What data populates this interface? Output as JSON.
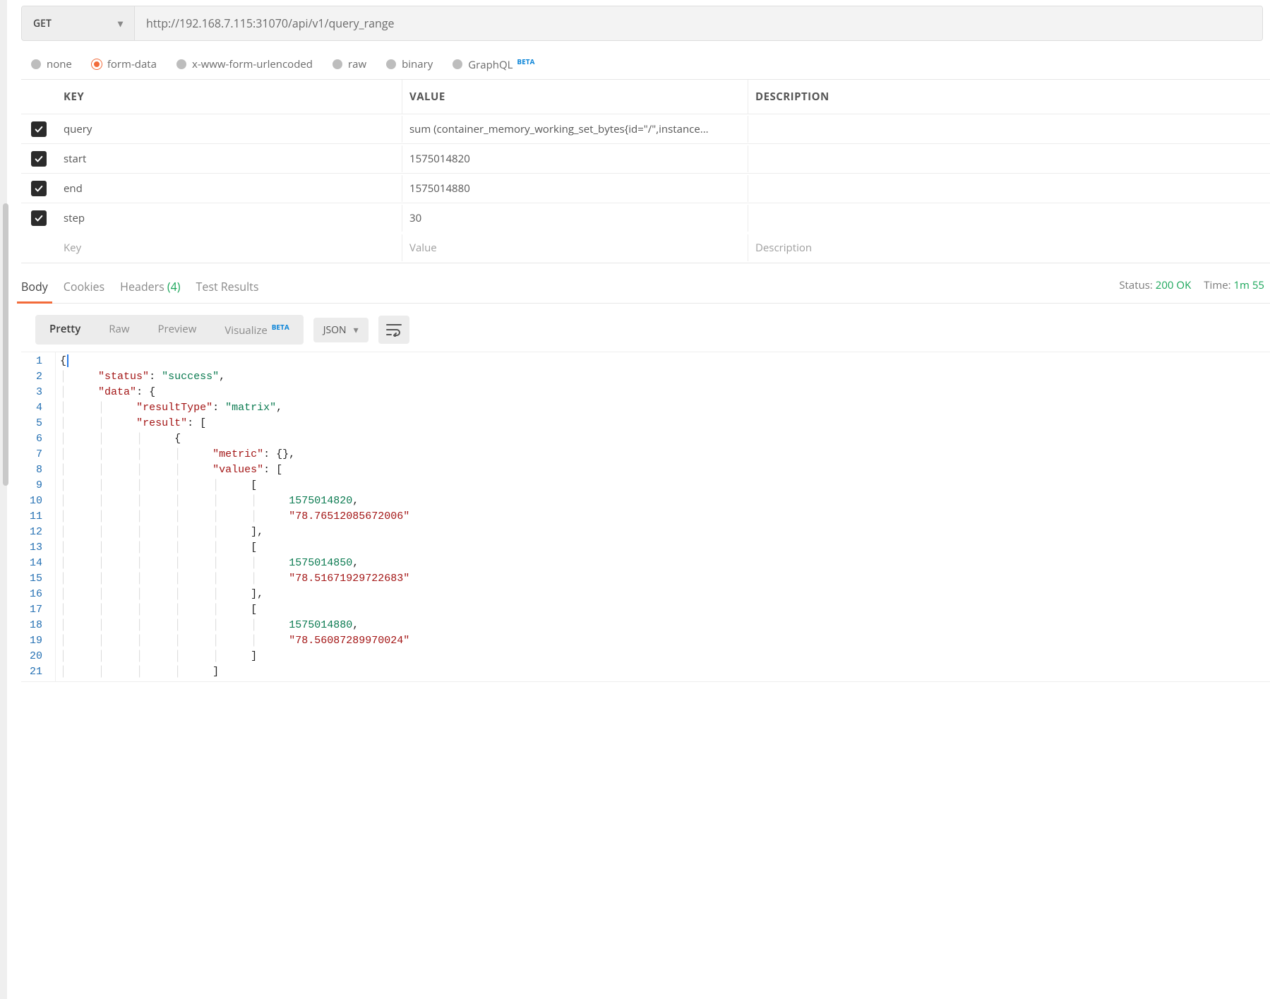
{
  "request": {
    "method": "GET",
    "url": "http://192.168.7.115:31070/api/v1/query_range"
  },
  "body_types": {
    "options": [
      "none",
      "form-data",
      "x-www-form-urlencoded",
      "raw",
      "binary"
    ],
    "graphql": "GraphQL",
    "beta": "BETA",
    "selected": "form-data"
  },
  "params": {
    "headers": {
      "key": "KEY",
      "value": "VALUE",
      "description": "DESCRIPTION"
    },
    "rows": [
      {
        "checked": true,
        "key": "query",
        "value": "sum (container_memory_working_set_bytes{id=\"/\",instance...",
        "description": ""
      },
      {
        "checked": true,
        "key": "start",
        "value": "1575014820",
        "description": ""
      },
      {
        "checked": true,
        "key": "end",
        "value": "1575014880",
        "description": ""
      },
      {
        "checked": true,
        "key": "step",
        "value": "30",
        "description": ""
      }
    ],
    "placeholders": {
      "key": "Key",
      "value": "Value",
      "description": "Description"
    }
  },
  "response_tabs": {
    "items": [
      {
        "label": "Body",
        "count": null,
        "active": true
      },
      {
        "label": "Cookies",
        "count": null,
        "active": false
      },
      {
        "label": "Headers",
        "count": "(4)",
        "active": false
      },
      {
        "label": "Test Results",
        "count": null,
        "active": false
      }
    ],
    "status_label": "Status:",
    "status_value": "200 OK",
    "time_label": "Time:",
    "time_value": "1m 55"
  },
  "format_bar": {
    "segments": [
      {
        "label": "Pretty",
        "active": true
      },
      {
        "label": "Raw",
        "active": false
      },
      {
        "label": "Preview",
        "active": false
      }
    ],
    "visualize": "Visualize",
    "beta": "BETA",
    "lang": "JSON"
  },
  "json_lines": [
    {
      "n": 1,
      "indent": 0,
      "parts": [
        {
          "t": "punc",
          "v": "{"
        }
      ],
      "caret_after": true
    },
    {
      "n": 2,
      "indent": 1,
      "parts": [
        {
          "t": "key",
          "v": "\"status\""
        },
        {
          "t": "punc",
          "v": ": "
        },
        {
          "t": "str",
          "v": "\"success\""
        },
        {
          "t": "punc",
          "v": ","
        }
      ]
    },
    {
      "n": 3,
      "indent": 1,
      "parts": [
        {
          "t": "key",
          "v": "\"data\""
        },
        {
          "t": "punc",
          "v": ": {"
        }
      ]
    },
    {
      "n": 4,
      "indent": 2,
      "parts": [
        {
          "t": "key",
          "v": "\"resultType\""
        },
        {
          "t": "punc",
          "v": ": "
        },
        {
          "t": "str",
          "v": "\"matrix\""
        },
        {
          "t": "punc",
          "v": ","
        }
      ]
    },
    {
      "n": 5,
      "indent": 2,
      "parts": [
        {
          "t": "key",
          "v": "\"result\""
        },
        {
          "t": "punc",
          "v": ": ["
        }
      ]
    },
    {
      "n": 6,
      "indent": 3,
      "parts": [
        {
          "t": "punc",
          "v": "{"
        }
      ]
    },
    {
      "n": 7,
      "indent": 4,
      "parts": [
        {
          "t": "key",
          "v": "\"metric\""
        },
        {
          "t": "punc",
          "v": ": {},"
        }
      ]
    },
    {
      "n": 8,
      "indent": 4,
      "parts": [
        {
          "t": "key",
          "v": "\"values\""
        },
        {
          "t": "punc",
          "v": ": ["
        }
      ]
    },
    {
      "n": 9,
      "indent": 5,
      "parts": [
        {
          "t": "punc",
          "v": "["
        }
      ]
    },
    {
      "n": 10,
      "indent": 6,
      "parts": [
        {
          "t": "num",
          "v": "1575014820"
        },
        {
          "t": "punc",
          "v": ","
        }
      ]
    },
    {
      "n": 11,
      "indent": 6,
      "parts": [
        {
          "t": "strr",
          "v": "\"78.76512085672006\""
        }
      ]
    },
    {
      "n": 12,
      "indent": 5,
      "parts": [
        {
          "t": "punc",
          "v": "],"
        }
      ]
    },
    {
      "n": 13,
      "indent": 5,
      "parts": [
        {
          "t": "punc",
          "v": "["
        }
      ]
    },
    {
      "n": 14,
      "indent": 6,
      "parts": [
        {
          "t": "num",
          "v": "1575014850"
        },
        {
          "t": "punc",
          "v": ","
        }
      ]
    },
    {
      "n": 15,
      "indent": 6,
      "parts": [
        {
          "t": "strr",
          "v": "\"78.51671929722683\""
        }
      ]
    },
    {
      "n": 16,
      "indent": 5,
      "parts": [
        {
          "t": "punc",
          "v": "],"
        }
      ]
    },
    {
      "n": 17,
      "indent": 5,
      "parts": [
        {
          "t": "punc",
          "v": "["
        }
      ]
    },
    {
      "n": 18,
      "indent": 6,
      "parts": [
        {
          "t": "num",
          "v": "1575014880"
        },
        {
          "t": "punc",
          "v": ","
        }
      ]
    },
    {
      "n": 19,
      "indent": 6,
      "parts": [
        {
          "t": "strr",
          "v": "\"78.56087289970024\""
        }
      ]
    },
    {
      "n": 20,
      "indent": 5,
      "parts": [
        {
          "t": "punc",
          "v": "]"
        }
      ]
    },
    {
      "n": 21,
      "indent": 4,
      "parts": [
        {
          "t": "punc",
          "v": "]"
        }
      ]
    }
  ]
}
